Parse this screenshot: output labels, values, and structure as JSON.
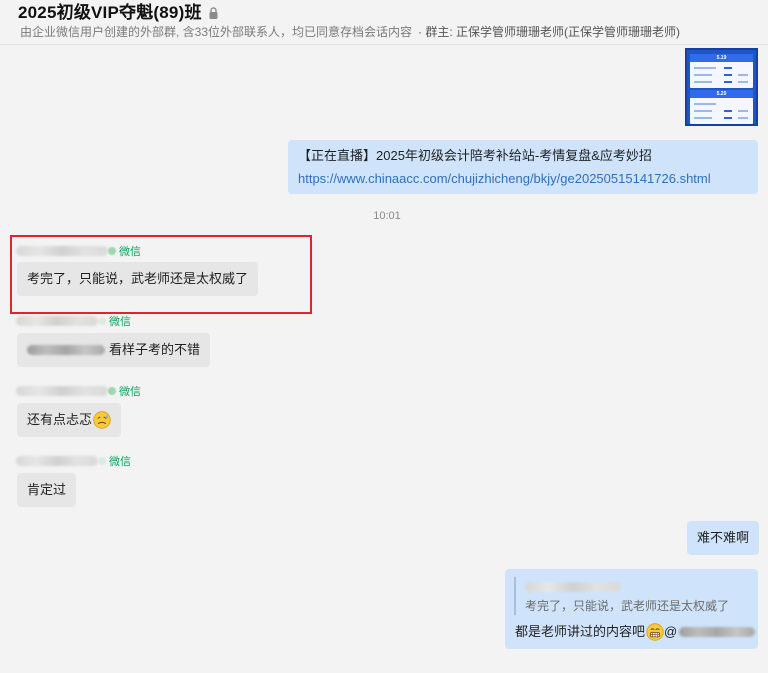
{
  "header": {
    "title": "2025初级VIP夺魁(89)班",
    "subtitle": "由企业微信用户创建的外部群, 含33位外部联系人，均已同意存档会话内容",
    "owner": "· 群主: 正保学管师珊珊老师(正保学管师珊珊老师)"
  },
  "image_card": {
    "band1": "5.19",
    "band2": "5.20"
  },
  "messages": {
    "live": {
      "text": "【正在直播】2025年初级会计陪考补给站-考情复盘&应考妙招",
      "link": "https://www.chinaacc.com/chujizhicheng/bkjy/ge20250515141726.shtml"
    },
    "time": "10:01",
    "wechat_tag": "微信",
    "m1": "考完了，只能说，武老师还是太权威了",
    "m2": "看样子考的不错",
    "m3": "还有点忐忑",
    "m4": "肯定过",
    "m5": "难不难啊",
    "quote": {
      "quoted": "考完了，只能说，武老师还是太权威了",
      "reply": "都是老师讲过的内容吧",
      "at": "@"
    }
  },
  "colors": {
    "outgoing_bubble": "#cfe4fb",
    "incoming_bubble": "#e6e6e6",
    "link": "#2f6fbd",
    "wechat_green": "#07a65f",
    "highlight_border": "#e0242d"
  },
  "icons": [
    "lock-icon",
    "wechat-dot-icon",
    "grimace-emoji-icon",
    "cold-sweat-emoji-icon"
  ]
}
